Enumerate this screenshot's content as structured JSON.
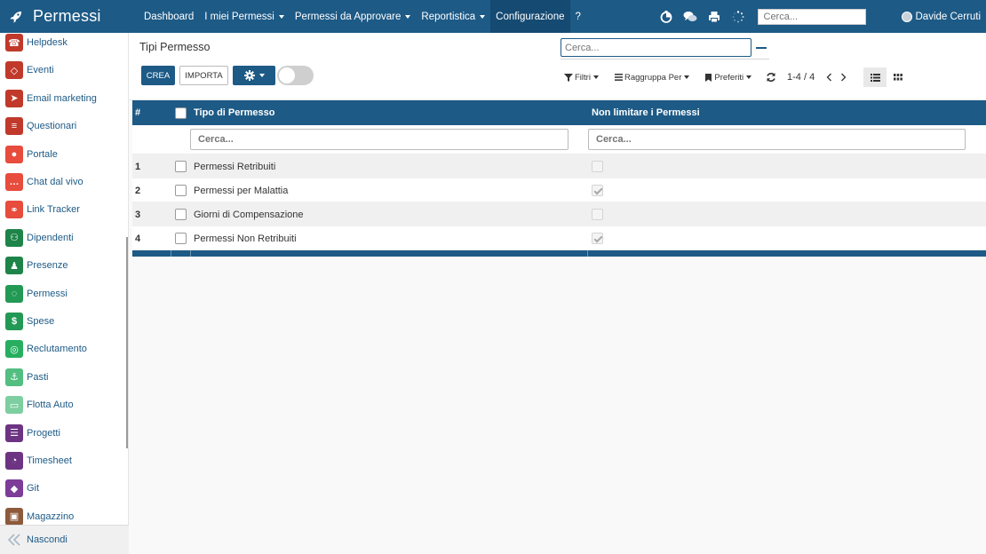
{
  "app": {
    "title": "Permessi"
  },
  "topbar": {
    "menu": [
      {
        "label": "Dashboard",
        "dropdown": false,
        "active": false
      },
      {
        "label": "I miei Permessi",
        "dropdown": true,
        "active": false
      },
      {
        "label": "Permessi da Approvare",
        "dropdown": true,
        "active": false
      },
      {
        "label": "Reportistica",
        "dropdown": true,
        "active": false
      },
      {
        "label": "Configurazione",
        "dropdown": false,
        "active": true
      },
      {
        "label": "?",
        "dropdown": false,
        "active": false
      }
    ],
    "search_placeholder": "Cerca...",
    "user_name": "Davide Cerruti",
    "icons": [
      "activity-timer-icon",
      "discuss-icon",
      "print-icon",
      "loading-spinner-icon"
    ]
  },
  "sidebar": {
    "items": [
      {
        "label": "Helpdesk",
        "color": "#c0392b",
        "icon": "helpdesk-icon"
      },
      {
        "label": "Eventi",
        "color": "#c0392b",
        "icon": "events-icon"
      },
      {
        "label": "Email marketing",
        "color": "#c0392b",
        "icon": "email-marketing-icon"
      },
      {
        "label": "Questionari",
        "color": "#c0392b",
        "icon": "survey-icon"
      },
      {
        "label": "Portale",
        "color": "#e74c3c",
        "icon": "portal-icon"
      },
      {
        "label": "Chat dal vivo",
        "color": "#e74c3c",
        "icon": "live-chat-icon"
      },
      {
        "label": "Link Tracker",
        "color": "#e74c3c",
        "icon": "link-tracker-icon"
      },
      {
        "label": "Dipendenti",
        "color": "#1e8449",
        "icon": "employees-icon"
      },
      {
        "label": "Presenze",
        "color": "#1e8449",
        "icon": "attendance-icon"
      },
      {
        "label": "Permessi",
        "color": "#229954",
        "icon": "leaves-icon"
      },
      {
        "label": "Spese",
        "color": "#229954",
        "icon": "expenses-icon"
      },
      {
        "label": "Reclutamento",
        "color": "#27ae60",
        "icon": "recruitment-icon"
      },
      {
        "label": "Pasti",
        "color": "#52be80",
        "icon": "lunch-icon"
      },
      {
        "label": "Flotta Auto",
        "color": "#7dcea0",
        "icon": "fleet-icon"
      },
      {
        "label": "Progetti",
        "color": "#6c3483",
        "icon": "projects-icon"
      },
      {
        "label": "Timesheet",
        "color": "#6c3483",
        "icon": "timesheet-icon"
      },
      {
        "label": "Git",
        "color": "#7d3c98",
        "icon": "git-icon"
      },
      {
        "label": "Magazzino",
        "color": "#8d5a3b",
        "icon": "inventory-icon"
      }
    ],
    "footer_label": "Nascondi"
  },
  "control_panel": {
    "title": "Tipi Permesso",
    "create_label": "CREA",
    "import_label": "IMPORTA",
    "search_placeholder": "Cerca...",
    "filters_label": "Filtri",
    "group_by_label": "Raggruppa Per",
    "favorites_label": "Preferiti",
    "pager_value": "1-4 / 4"
  },
  "table": {
    "headers": {
      "num": "#",
      "type": "Tipo di Permesso",
      "limit": "Non limitare i Permessi"
    },
    "filter_placeholder_type": "Cerca...",
    "filter_placeholder_limit": "Cerca...",
    "rows": [
      {
        "num": "1",
        "type": "Permessi Retribuiti",
        "unlimited": false
      },
      {
        "num": "2",
        "type": "Permessi per Malattia",
        "unlimited": true
      },
      {
        "num": "3",
        "type": "Giorni di Compensazione",
        "unlimited": false
      },
      {
        "num": "4",
        "type": "Permessi Non Retribuiti",
        "unlimited": true
      }
    ]
  }
}
